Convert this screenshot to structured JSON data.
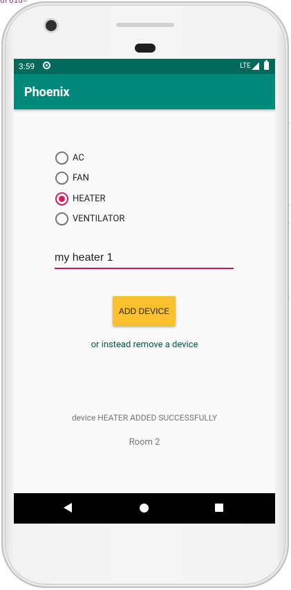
{
  "background": {
    "ide_fragment": "droid="
  },
  "status_bar": {
    "time": "3:59",
    "network": "LTE"
  },
  "app_bar": {
    "title": "Phoenix"
  },
  "device_types": [
    {
      "label": "AC",
      "checked": false
    },
    {
      "label": "FAN",
      "checked": false
    },
    {
      "label": "HEATER",
      "checked": true
    },
    {
      "label": "VENTILATOR",
      "checked": false
    }
  ],
  "device_name_input": {
    "value": "my heater 1"
  },
  "add_button": {
    "label": "ADD DEVICE"
  },
  "remove_link": {
    "label": "or instead remove a device"
  },
  "status_message": "device HEATER ADDED SUCCESSFULLY",
  "room_label": "Room 2",
  "colors": {
    "status_bar": "#00695c",
    "app_bar": "#00897b",
    "accent": "#d81b60",
    "button": "#fbc02d",
    "link": "#00574b"
  },
  "icons": [
    "sync-icon",
    "signal-icon",
    "battery-icon",
    "back-icon",
    "home-icon",
    "recents-icon",
    "camera",
    "speaker"
  ]
}
